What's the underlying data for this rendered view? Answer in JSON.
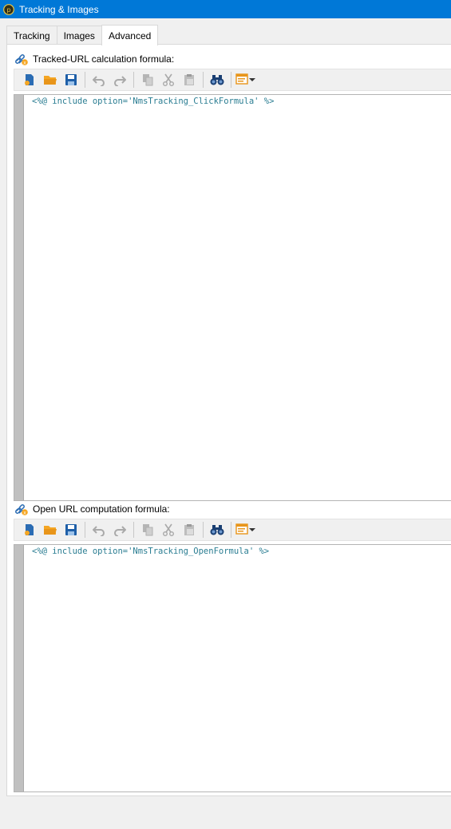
{
  "window": {
    "title": "Tracking & Images",
    "app_icon": "adobe-campaign-icon"
  },
  "tabs": [
    {
      "label": "Tracking",
      "active": false
    },
    {
      "label": "Images",
      "active": false
    },
    {
      "label": "Advanced",
      "active": true
    }
  ],
  "sections": [
    {
      "label": "Tracked-URL calculation formula:",
      "icon": "link-formula-icon",
      "code": "<%@ include option='NmsTracking_ClickFormula' %>"
    },
    {
      "label": "Open URL computation formula:",
      "icon": "link-formula-icon",
      "code": "<%@ include option='NmsTracking_OpenFormula' %>"
    }
  ],
  "toolbar_icons": [
    "new-document-icon",
    "open-folder-icon",
    "save-icon",
    "undo-icon",
    "redo-icon",
    "copy-icon",
    "cut-icon",
    "paste-icon",
    "find-binoculars-icon",
    "insert-field-icon"
  ],
  "colors": {
    "titlebar": "#0078d7",
    "code_text": "#2a7d92",
    "folder": "#f5a623",
    "save": "#1e5fa8",
    "find": "#1a3f73"
  }
}
